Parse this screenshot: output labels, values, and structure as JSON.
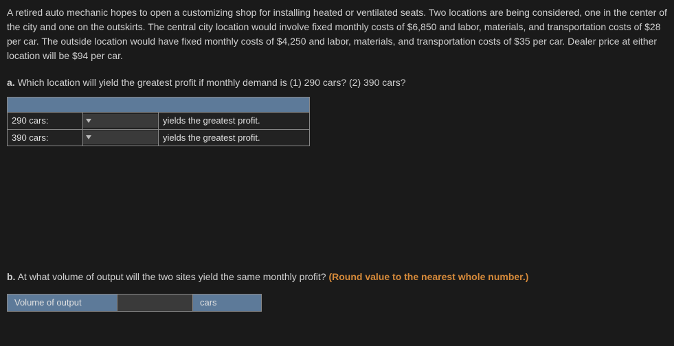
{
  "problem": {
    "text": "A retired auto mechanic hopes to open a customizing shop for installing heated or ventilated seats. Two locations are being considered, one in the center of the city and one on the outskirts. The central city location would involve fixed monthly costs of $6,850 and labor, materials, and transportation costs of $28 per car. The outside location would have fixed monthly costs of $4,250 and labor, materials, and transportation costs of $35 per car. Dealer price at either location will be $94 per car."
  },
  "partA": {
    "label": "a.",
    "question": "Which location will yield the greatest profit if monthly demand is (1) 290 cars? (2) 390 cars?",
    "rows": [
      {
        "label": "290 cars:",
        "tail": "yields the greatest profit."
      },
      {
        "label": "390 cars:",
        "tail": "yields the greatest profit."
      }
    ]
  },
  "partB": {
    "label": "b.",
    "question": "At what volume of output will the two sites yield the same monthly profit?",
    "round_note": "(Round value to the nearest whole number.)",
    "header": "Volume of output",
    "unit": "cars"
  }
}
